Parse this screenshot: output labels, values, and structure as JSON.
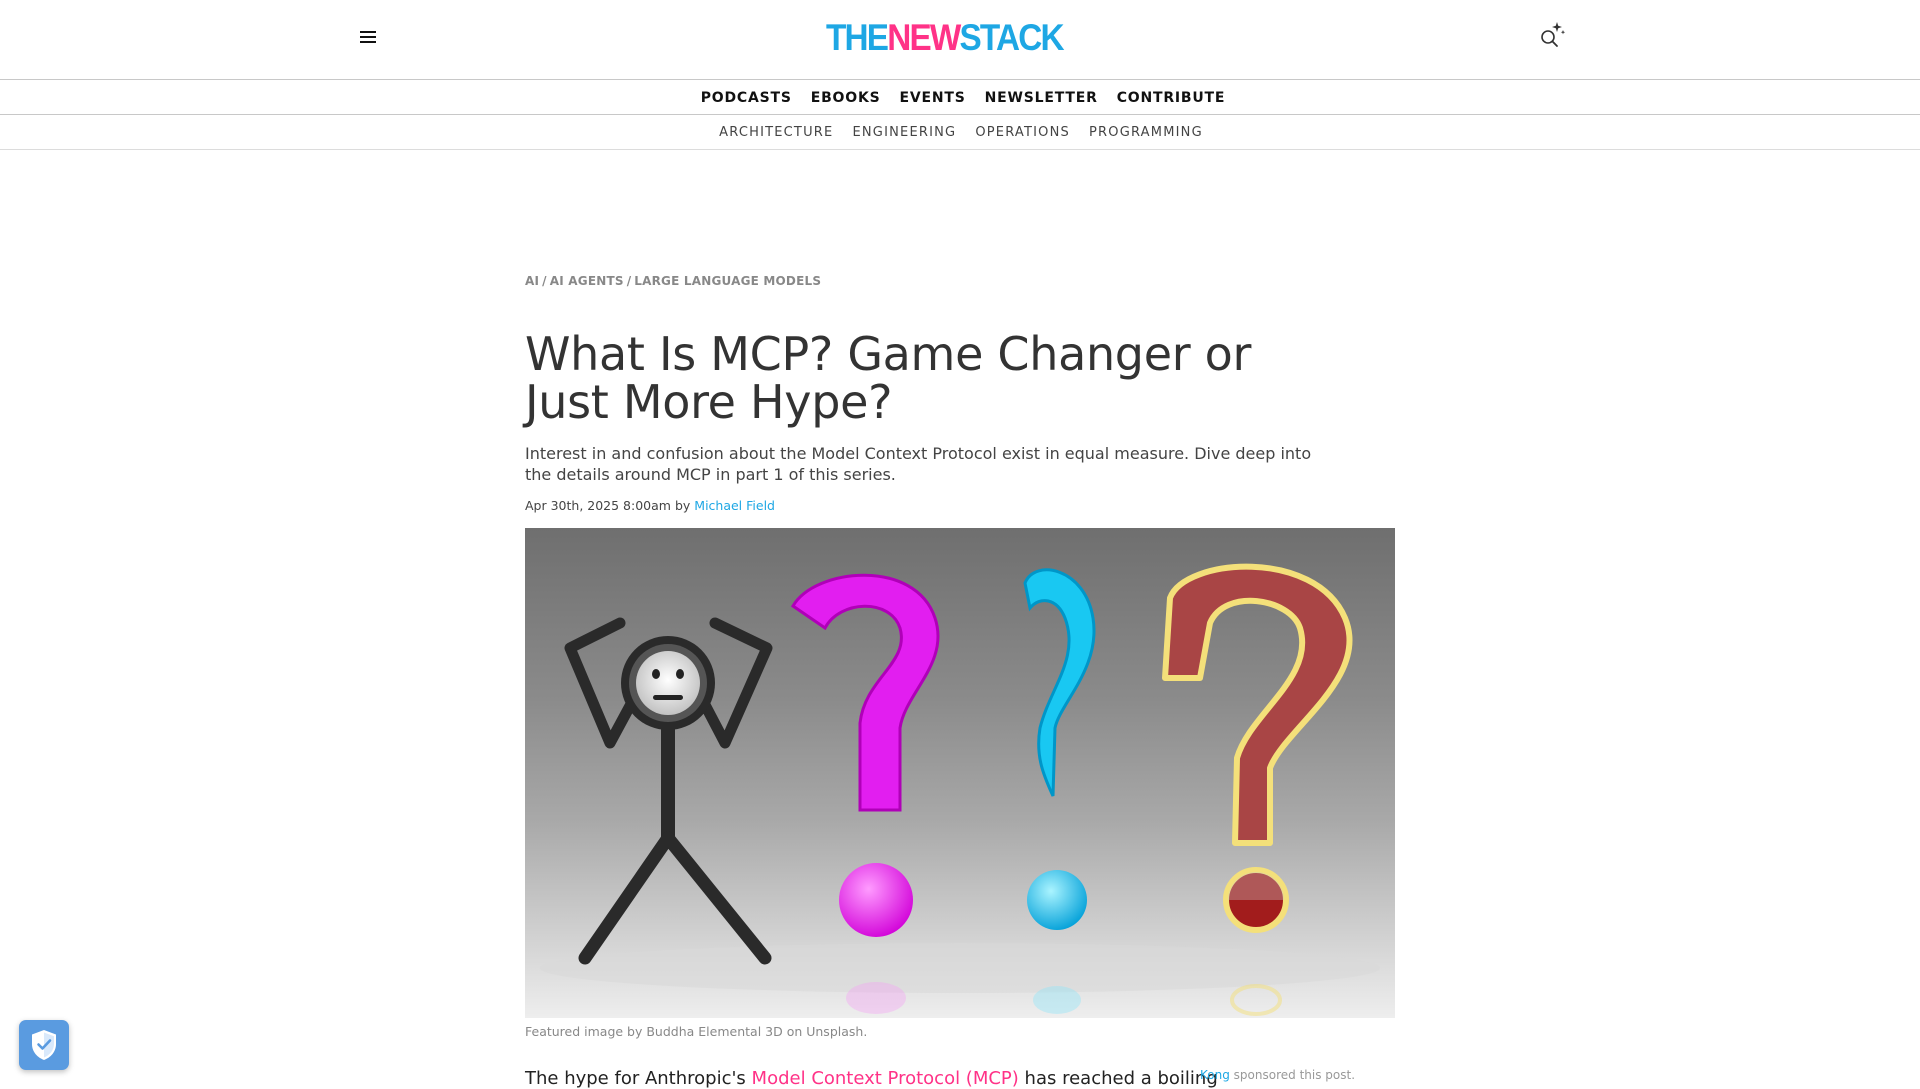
{
  "header": {
    "logo": {
      "part1": "THE",
      "part2": "NEW",
      "part3": "STACK"
    },
    "brand_colors": {
      "blue": "#1ea7e4",
      "pink": "#ff3287"
    },
    "menu_icon": "hamburger-menu-icon",
    "search_icon": "sparkle-search-icon"
  },
  "nav_primary": [
    "PODCASTS",
    "EBOOKS",
    "EVENTS",
    "NEWSLETTER",
    "CONTRIBUTE"
  ],
  "nav_secondary": [
    "ARCHITECTURE",
    "ENGINEERING",
    "OPERATIONS",
    "PROGRAMMING"
  ],
  "article": {
    "breadcrumb": [
      "AI",
      "AI AGENTS",
      "LARGE LANGUAGE MODELS"
    ],
    "breadcrumb_separator": "/",
    "title": "What Is MCP? Game Changer or Just More Hype?",
    "subtitle": "Interest in and confusion about the Model Context Protocol exist in equal measure. Dive deep into the details around MCP in part 1 of this series.",
    "date": "Apr 30th, 2025 8:00am",
    "by": "by",
    "author": "Michael Field",
    "hero_caption": "Featured image by Buddha Elemental 3D on Unsplash.",
    "body_start": "The hype for Anthropic's",
    "body_link": "Model Context Protocol (MCP)",
    "body_rest": "has reached a boiling",
    "sponsor_name": "Kong",
    "sponsor_text": "sponsored this post."
  },
  "privacy": {
    "icon": "shield-check-icon",
    "color": "#5a9be0"
  }
}
